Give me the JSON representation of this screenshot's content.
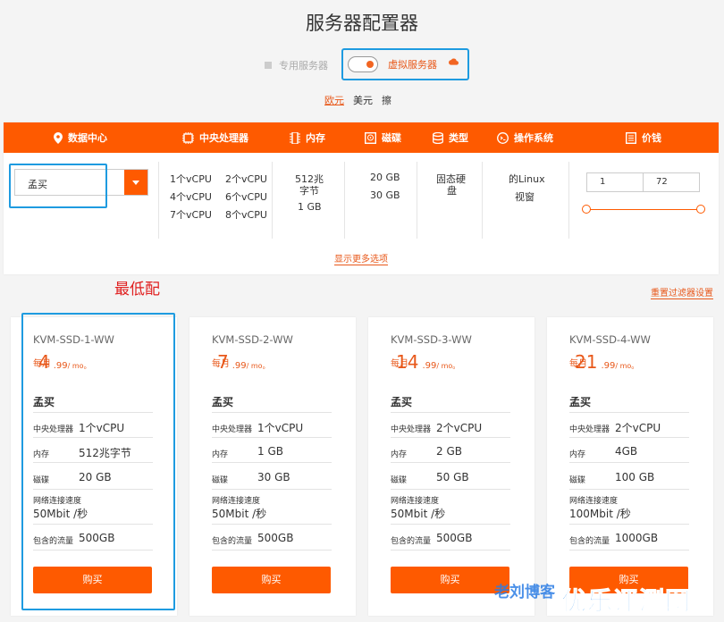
{
  "page_title": "服务器配置器",
  "server_type": {
    "dedicated": "专用服务器",
    "virtual": "虚拟服务器"
  },
  "currencies": [
    "欧元",
    "美元",
    "擦"
  ],
  "filter_headers": [
    "数据中心",
    "中央处理器",
    "内存",
    "磁碟",
    "类型",
    "操作系统",
    "价钱"
  ],
  "datacenter": {
    "selected": "孟买"
  },
  "cpu_options": [
    "1个vCPU",
    "2个vCPU",
    "4个vCPU",
    "6个vCPU",
    "7个vCPU",
    "8个vCPU"
  ],
  "ram_options": [
    "512兆",
    "字节",
    "1 GB"
  ],
  "disk_options": [
    "20 GB",
    "30 GB"
  ],
  "type_options": [
    "固态硬",
    "盘"
  ],
  "os_options": [
    "的Linux",
    "视窗"
  ],
  "price_range": {
    "min": "1",
    "max": "72"
  },
  "show_more": "显示更多选项",
  "annotation_lowest": "最低配",
  "reset_filters": "重置过滤器设置",
  "card_labels": {
    "cpu": "中央处理器",
    "ram": "内存",
    "disk": "磁碟",
    "net": "网络连接速度",
    "traffic": "包含的流量"
  },
  "cards": [
    {
      "name": "KVM-SSD-1-WW",
      "price_month": "每月",
      "price_int": "4",
      "price_cents": ".99",
      "price_unit": "/ mo。",
      "location": "孟买",
      "cpu": "1个vCPU",
      "ram": "512兆字节",
      "disk": "20 GB",
      "net": "50Mbit /秒",
      "traffic": "500GB",
      "buy": "购买"
    },
    {
      "name": "KVM-SSD-2-WW",
      "price_month": "每月",
      "price_int": "7",
      "price_cents": ".99",
      "price_unit": "/ mo。",
      "location": "孟买",
      "cpu": "1个vCPU",
      "ram": "1 GB",
      "disk": "30 GB",
      "net": "50Mbit /秒",
      "traffic": "500GB",
      "buy": "购买"
    },
    {
      "name": "KVM-SSD-3-WW",
      "price_month": "每月",
      "price_int": "14",
      "price_cents": ".99",
      "price_unit": "/ mo。",
      "location": "孟买",
      "cpu": "2个vCPU",
      "ram": "2 GB",
      "disk": "50 GB",
      "net": "50Mbit /秒",
      "traffic": "500GB",
      "buy": "购买"
    },
    {
      "name": "KVM-SSD-4-WW",
      "price_month": "每月",
      "price_int": "21",
      "price_cents": ".99",
      "price_unit": "/ mo。",
      "location": "孟买",
      "cpu": "2个vCPU",
      "ram": "4GB",
      "disk": "100 GB",
      "net": "100Mbit /秒",
      "traffic": "1000GB",
      "buy": "购买"
    }
  ],
  "watermarks": [
    "老刘博客",
    "优乐评测网"
  ],
  "colors": {
    "accent": "#fe5a00",
    "highlight": "#1e9be0",
    "annotation": "#e02020"
  }
}
